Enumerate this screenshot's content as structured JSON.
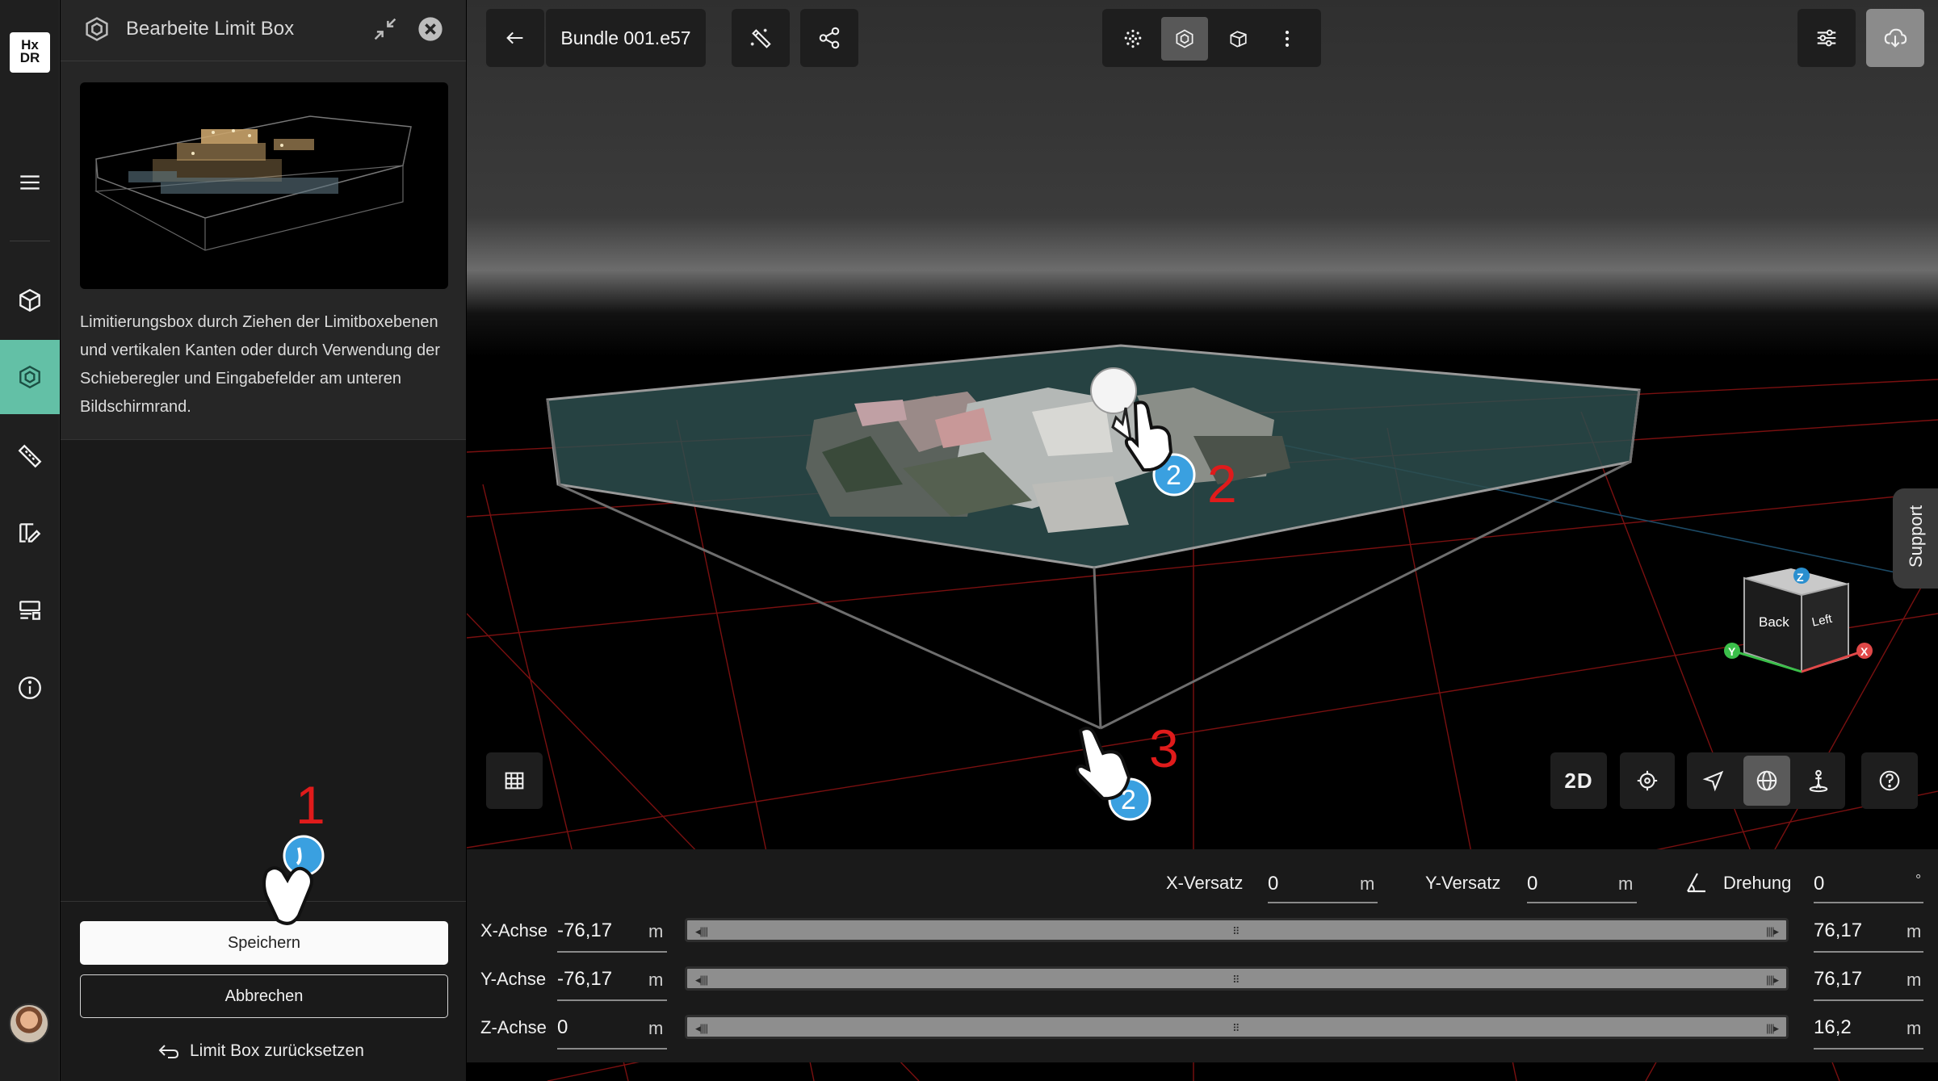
{
  "app": {
    "logo": "Hx\nDR"
  },
  "rail": {
    "items": [
      {
        "name": "menu",
        "icon": "menu-icon"
      },
      {
        "name": "model",
        "icon": "cube-icon"
      },
      {
        "name": "limit-box",
        "icon": "limit-box-icon",
        "active": true
      },
      {
        "name": "measure",
        "icon": "ruler-icon"
      },
      {
        "name": "annotate",
        "icon": "edit-text-icon"
      },
      {
        "name": "layers",
        "icon": "layers-icon"
      },
      {
        "name": "info",
        "icon": "info-icon"
      }
    ]
  },
  "panel": {
    "title": "Bearbeite Limit Box",
    "description": "Limitierungsbox durch Ziehen der Limitboxebenen und vertikalen Kanten oder durch Verwendung der Schieberegler und Eingabefelder am unteren Bildschirmrand.",
    "save_label": "Speichern",
    "cancel_label": "Abbrechen",
    "reset_label": "Limit Box zurücksetzen"
  },
  "toolbar": {
    "title": "Bundle 001.e57",
    "view_modes": [
      "point-cloud-icon",
      "limit-box-view-icon",
      "cube-edit-icon",
      "more-icon"
    ]
  },
  "support": {
    "label": "Support"
  },
  "navcube": {
    "z": "Z",
    "y": "Y",
    "x": "X",
    "back": "Back",
    "left": "Left"
  },
  "view_buttons": {
    "two_d": "2D"
  },
  "annotations": {
    "step1": "1",
    "step2": "2",
    "step3": "3",
    "marker": "2"
  },
  "controls": {
    "offset": {
      "x_label": "X-Versatz",
      "x_value": "0",
      "x_unit": "m",
      "y_label": "Y-Versatz",
      "y_value": "0",
      "y_unit": "m",
      "rotation_label": "Drehung",
      "rotation_value": "0",
      "rotation_unit": "°"
    },
    "axes": [
      {
        "label": "X-Achse",
        "min": "-76,17",
        "max": "76,17",
        "unit": "m"
      },
      {
        "label": "Y-Achse",
        "min": "-76,17",
        "max": "76,17",
        "unit": "m"
      },
      {
        "label": "Z-Achse",
        "min": "0",
        "max": "16,2",
        "unit": "m"
      }
    ]
  },
  "colors": {
    "accent": "#63c0a6",
    "annotation": "#e01b1b",
    "marker": "#3aa0e0"
  }
}
